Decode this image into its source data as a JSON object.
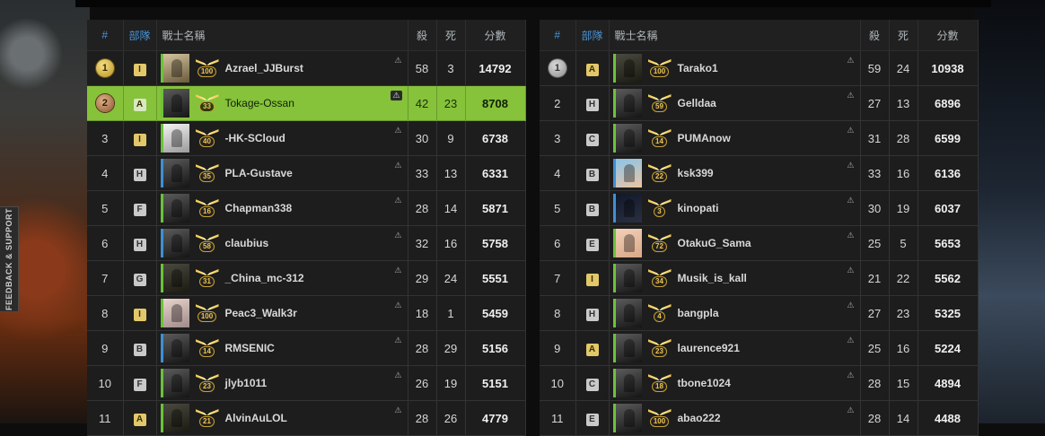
{
  "sidebar": {
    "feedback_label": "FEEDBACK & SUPPORT"
  },
  "headers": {
    "rank": "#",
    "squad": "部隊",
    "name": "戰士名稱",
    "kills": "殺",
    "deaths": "死",
    "score": "分數"
  },
  "colors": {
    "highlight": "#86c23a",
    "header_accent": "#4a93d6",
    "squad_marker": "#e2c86a"
  },
  "team1": [
    {
      "rank": "1",
      "squad": "I",
      "avatar": "a1",
      "rank_level": "100",
      "name": "Azrael_JJBurst",
      "kills": "58",
      "deaths": "3",
      "score": "14792",
      "medal": "gold"
    },
    {
      "rank": "2",
      "squad": "A",
      "avatar": "",
      "rank_level": "33",
      "name": "Tokage-Ossan",
      "kills": "42",
      "deaths": "23",
      "score": "8708",
      "medal": "bronze",
      "highlight": true
    },
    {
      "rank": "3",
      "squad": "I",
      "avatar": "a2",
      "rank_level": "40",
      "name": "-HK-SCloud",
      "kills": "30",
      "deaths": "9",
      "score": "6738"
    },
    {
      "rank": "4",
      "squad": "H",
      "avatar": "",
      "rank_level": "35",
      "name": "PLA-Gustave",
      "kills": "33",
      "deaths": "13",
      "score": "6331"
    },
    {
      "rank": "5",
      "squad": "F",
      "avatar": "",
      "rank_level": "16",
      "name": "Chapman338",
      "kills": "28",
      "deaths": "14",
      "score": "5871"
    },
    {
      "rank": "6",
      "squad": "H",
      "avatar": "",
      "rank_level": "58",
      "name": "claubius",
      "kills": "32",
      "deaths": "16",
      "score": "5758"
    },
    {
      "rank": "7",
      "squad": "G",
      "avatar": "a4",
      "rank_level": "31",
      "name": "_China_mc-312",
      "kills": "29",
      "deaths": "24",
      "score": "5551"
    },
    {
      "rank": "8",
      "squad": "I",
      "avatar": "a3",
      "rank_level": "100",
      "name": "Peac3_Walk3r",
      "kills": "18",
      "deaths": "1",
      "score": "5459"
    },
    {
      "rank": "9",
      "squad": "B",
      "avatar": "",
      "rank_level": "14",
      "name": "RMSENIC",
      "kills": "28",
      "deaths": "29",
      "score": "5156"
    },
    {
      "rank": "10",
      "squad": "F",
      "avatar": "",
      "rank_level": "23",
      "name": "jlyb1011",
      "kills": "26",
      "deaths": "19",
      "score": "5151"
    },
    {
      "rank": "11",
      "squad": "A",
      "avatar": "a4",
      "rank_level": "21",
      "name": "AlvinAuLOL",
      "kills": "28",
      "deaths": "26",
      "score": "4779"
    }
  ],
  "team2": [
    {
      "rank": "1",
      "squad": "A",
      "avatar": "a4",
      "rank_level": "100",
      "name": "Tarako1",
      "kills": "59",
      "deaths": "24",
      "score": "10938",
      "medal": "silver"
    },
    {
      "rank": "2",
      "squad": "H",
      "avatar": "",
      "rank_level": "59",
      "name": "Gelldaa",
      "kills": "27",
      "deaths": "13",
      "score": "6896"
    },
    {
      "rank": "3",
      "squad": "C",
      "avatar": "",
      "rank_level": "14",
      "name": "PUMAnow",
      "kills": "31",
      "deaths": "28",
      "score": "6599"
    },
    {
      "rank": "4",
      "squad": "B",
      "avatar": "a6",
      "rank_level": "22",
      "name": "ksk399",
      "kills": "33",
      "deaths": "16",
      "score": "6136"
    },
    {
      "rank": "5",
      "squad": "B",
      "avatar": "a7",
      "rank_level": "3",
      "name": "kinopati",
      "kills": "30",
      "deaths": "19",
      "score": "6037"
    },
    {
      "rank": "6",
      "squad": "E",
      "avatar": "a8",
      "rank_level": "72",
      "name": "OtakuG_Sama",
      "kills": "25",
      "deaths": "5",
      "score": "5653"
    },
    {
      "rank": "7",
      "squad": "I",
      "avatar": "",
      "rank_level": "34",
      "name": "Musik_is_kall",
      "kills": "21",
      "deaths": "22",
      "score": "5562"
    },
    {
      "rank": "8",
      "squad": "H",
      "avatar": "",
      "rank_level": "4",
      "name": "bangpla",
      "kills": "27",
      "deaths": "23",
      "score": "5325"
    },
    {
      "rank": "9",
      "squad": "A",
      "avatar": "",
      "rank_level": "23",
      "name": "laurence921",
      "kills": "25",
      "deaths": "16",
      "score": "5224"
    },
    {
      "rank": "10",
      "squad": "C",
      "avatar": "",
      "rank_level": "18",
      "name": "tbone1024",
      "kills": "28",
      "deaths": "15",
      "score": "4894"
    },
    {
      "rank": "11",
      "squad": "E",
      "avatar": "",
      "rank_level": "100",
      "name": "abao222",
      "kills": "28",
      "deaths": "14",
      "score": "4488"
    }
  ]
}
